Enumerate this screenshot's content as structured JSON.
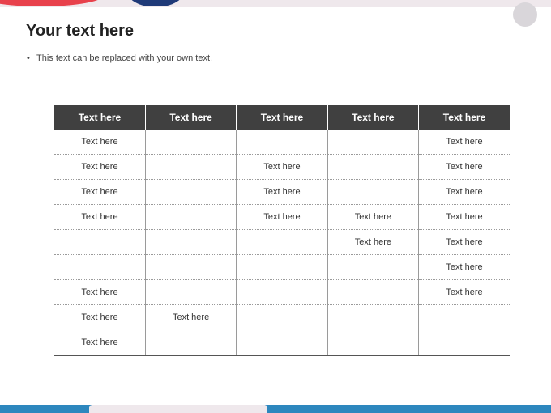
{
  "slide": {
    "title": "Your text here",
    "bullet": "This text can be replaced with your own text."
  },
  "table": {
    "headers": [
      "Text here",
      "Text here",
      "Text here",
      "Text here",
      "Text here"
    ],
    "rows": [
      [
        "Text here",
        "",
        "",
        "",
        "Text here"
      ],
      [
        "Text here",
        "",
        "Text here",
        "",
        "Text here"
      ],
      [
        "Text here",
        "",
        "Text here",
        "",
        "Text here"
      ],
      [
        "Text here",
        "",
        "Text here",
        "Text here",
        "Text here"
      ],
      [
        "",
        "",
        "",
        "Text here",
        "Text here"
      ],
      [
        "",
        "",
        "",
        "",
        "Text here"
      ],
      [
        "Text here",
        "",
        "",
        "",
        "Text here"
      ],
      [
        "Text here",
        "Text here",
        "",
        "",
        ""
      ],
      [
        "Text here",
        "",
        "",
        "",
        ""
      ]
    ]
  },
  "colors": {
    "header_bg": "#404040",
    "accent_red": "#e8414c",
    "accent_navy": "#1f3a78",
    "accent_blue": "#2d87be"
  }
}
